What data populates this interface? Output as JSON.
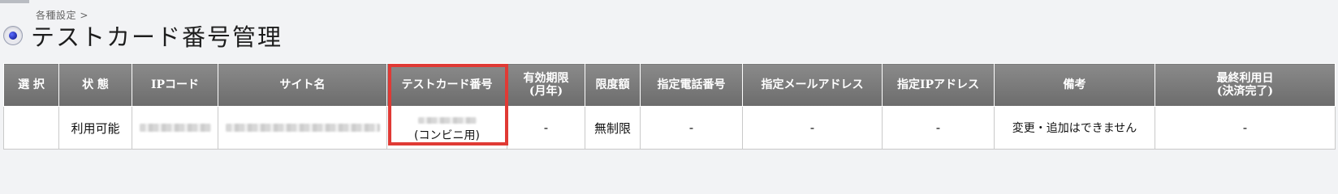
{
  "breadcrumb": "各種設定 >",
  "page_title": "テストカード番号管理",
  "table": {
    "headers": {
      "select": "選 択",
      "status": "状 態",
      "ip_code": "IPコード",
      "site_name": "サイト名",
      "test_card_number": "テストカード番号",
      "expiry_line1": "有効期限",
      "expiry_line2": "(月年)",
      "limit": "限度額",
      "phone": "指定電話番号",
      "email": "指定メールアドレス",
      "ip_address": "指定IPアドレス",
      "note": "備考",
      "last_used_line1": "最終利用日",
      "last_used_line2": "(決済完了)"
    },
    "rows": [
      {
        "select": "",
        "status": "利用可能",
        "card_suffix": "(コンビニ用)",
        "expiry": "-",
        "limit": "無制限",
        "phone": "-",
        "email": "-",
        "ip_address": "-",
        "note": "変更・追加はできません",
        "last_used": "-"
      }
    ]
  },
  "colors": {
    "header_bg": "#7a7a7a",
    "highlight_border": "#e03a35",
    "page_bg": "#f2f3f5"
  }
}
